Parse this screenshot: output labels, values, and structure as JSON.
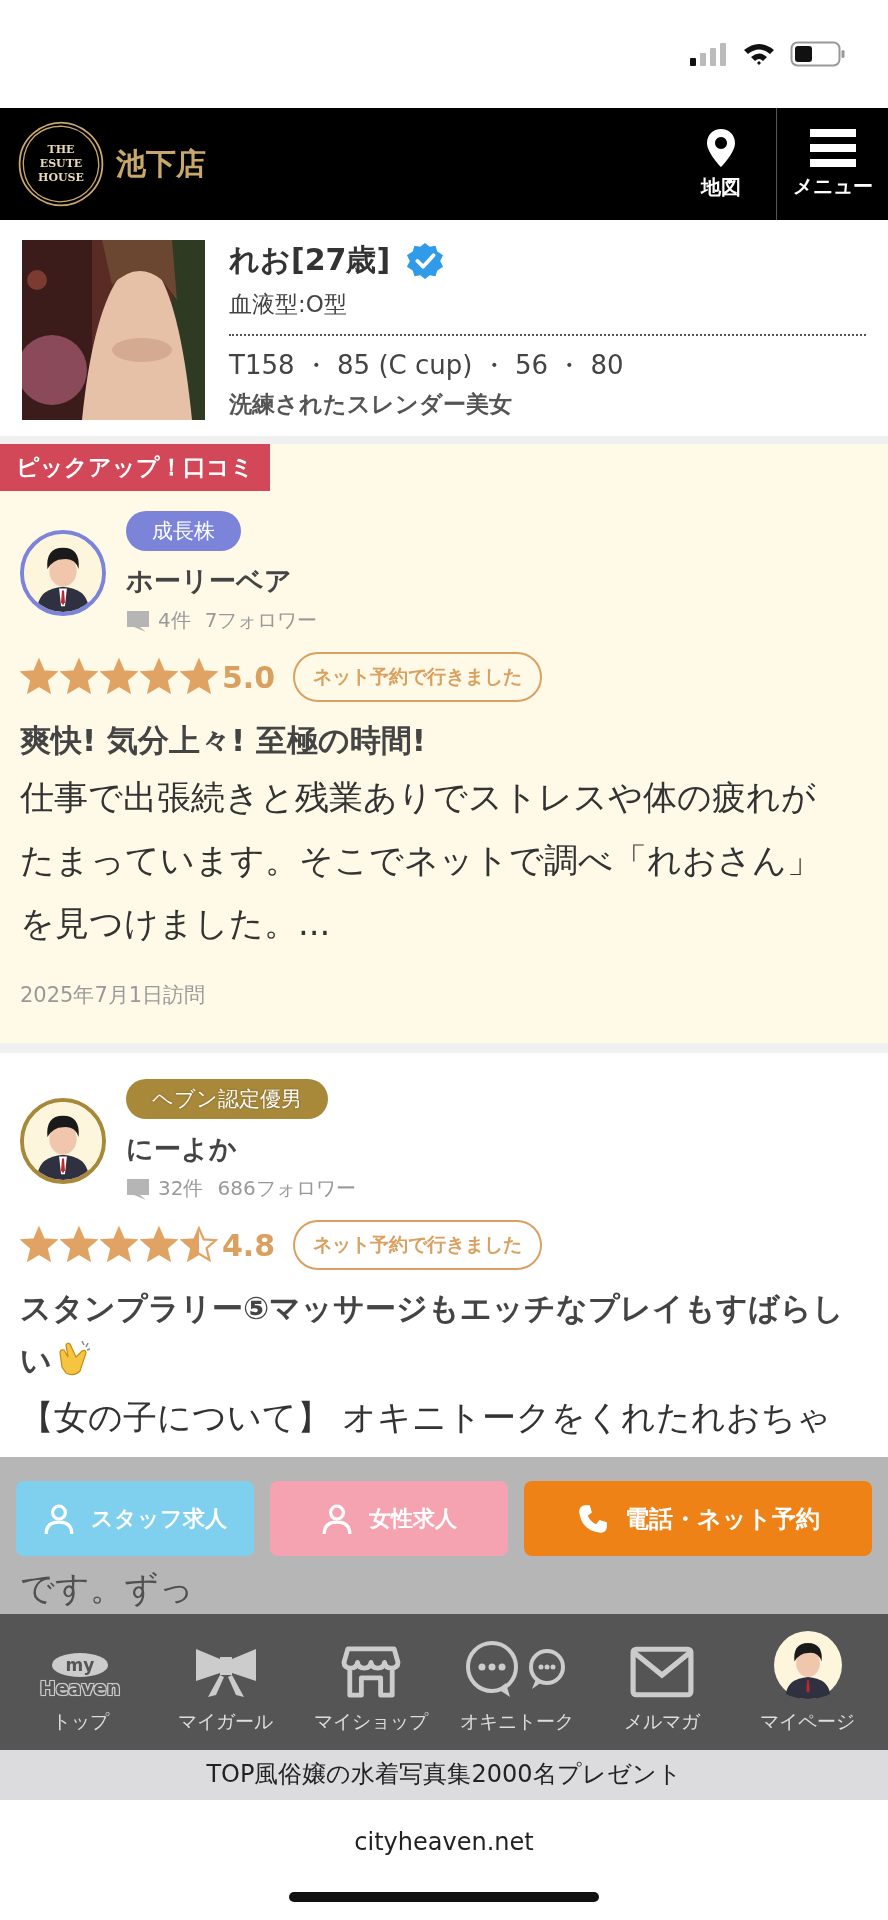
{
  "header": {
    "logo_lines": [
      "THE",
      "ESUTE",
      "HOUSE"
    ],
    "shop": "池下店",
    "buttons": [
      {
        "kind": "map",
        "label": "地図"
      },
      {
        "kind": "menu",
        "label": "メニュー"
      }
    ]
  },
  "profile": {
    "name": "れお[27歳]",
    "verified": true,
    "blood": "血液型:O型",
    "sizes": "T158 ・ 85 (C cup) ・ 56 ・ 80",
    "catch": "洗練されたスレンダー美女"
  },
  "reviews": [
    {
      "pickup": "ピックアップ！口コミ",
      "badge": "成長株",
      "color": "#7b84d8",
      "user": "ホーリーベア",
      "count": "4件",
      "followers": "7フォロワー",
      "stars": 5,
      "score": "5.0",
      "tag": "ネット予約で行きました",
      "title": "爽快! 気分上々! 至極の時間!",
      "clap": false,
      "body_lines": [
        "仕事で出張続きと残業ありでストレスや体の疲れが",
        "たまっています。そこでネットで調べ「れおさん」",
        "を見つけました。..."
      ],
      "date": "2025年7月1日訪問"
    },
    {
      "badge": "ヘブン認定優男",
      "color": "#a8893a",
      "user": "にーよか",
      "count": "32件",
      "followers": "686フォロワー",
      "stars": 4.5,
      "score": "4.8",
      "tag": "ネット予約で行きました",
      "title": "スタンプラリー⑤マッサージもエッチなプレイもすばらしい",
      "clap": true,
      "body_lines": [
        "【女の子について】 オキニトークをくれたれおちゃ",
        "です。ずっ"
      ]
    }
  ],
  "actions": [
    {
      "kind": "staff",
      "label": "スタッフ求人"
    },
    {
      "kind": "women",
      "label": "女性求人"
    },
    {
      "kind": "phone",
      "label": "電話・ネット予約"
    }
  ],
  "nav": [
    {
      "kind": "heaven",
      "logo_lines": [
        "my",
        "Heaven"
      ],
      "label": "トップ"
    },
    {
      "kind": "bow",
      "label": "マイガール"
    },
    {
      "kind": "shop",
      "label": "マイショップ"
    },
    {
      "kind": "chat",
      "label": "オキニトーク"
    },
    {
      "kind": "mail",
      "label": "メルマガ"
    },
    {
      "kind": "avatar",
      "label": "マイページ"
    }
  ],
  "promo": "TOP風俗嬢の水着写真集2000名プレゼント",
  "url": "cityheaven.net"
}
